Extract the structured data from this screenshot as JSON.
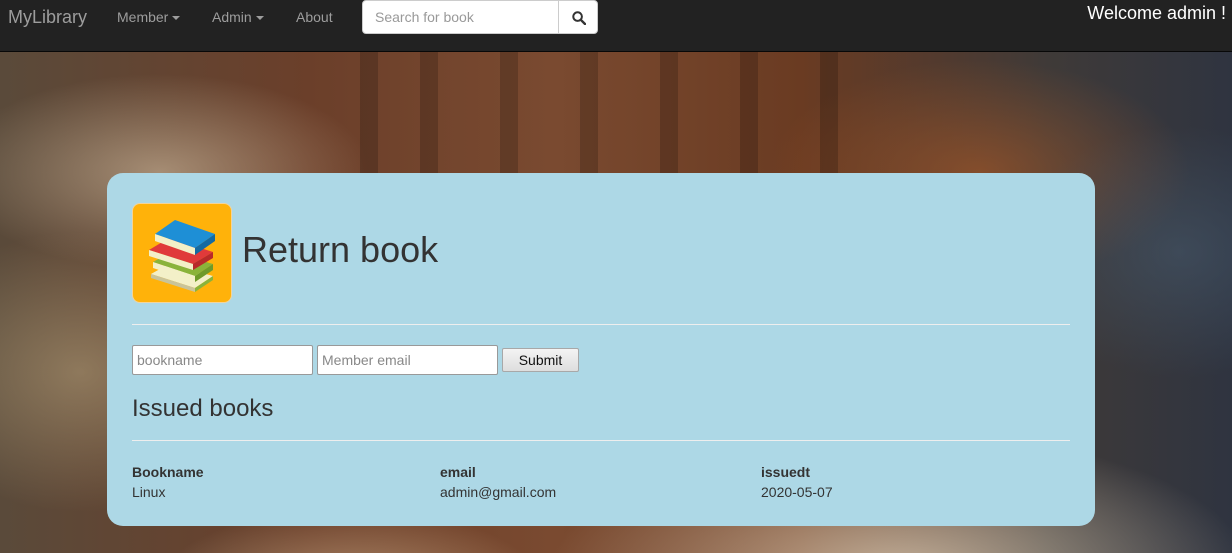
{
  "navbar": {
    "brand": "MyLibrary",
    "items": [
      {
        "label": "Member",
        "has_dropdown": true
      },
      {
        "label": "Admin",
        "has_dropdown": true
      },
      {
        "label": "About",
        "has_dropdown": false
      }
    ],
    "search": {
      "placeholder": "Search for book",
      "value": "",
      "icon": "search-icon"
    },
    "welcome": "Welcome admin !"
  },
  "page": {
    "logo_icon": "books-stack-icon",
    "title": "Return book",
    "form": {
      "bookname_placeholder": "bookname",
      "email_placeholder": "Member email",
      "submit_label": "Submit"
    },
    "issued_heading": "Issued books",
    "table": {
      "columns": [
        "Bookname",
        "email",
        "issuedt"
      ],
      "rows": [
        [
          "Linux",
          "admin@gmail.com",
          "2020-05-07"
        ]
      ]
    }
  },
  "colors": {
    "navbar_bg": "#222222",
    "card_bg": "#add8e6",
    "logo_bg": "#ffb20a"
  }
}
